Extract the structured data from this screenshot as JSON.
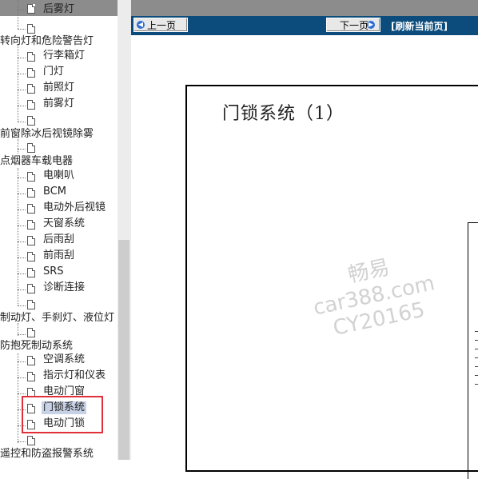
{
  "tree": {
    "items": [
      {
        "label": "后雾灯"
      },
      {
        "label": ""
      },
      {
        "label": "转向灯和危险警告灯"
      },
      {
        "label": "行李箱灯"
      },
      {
        "label": "门灯"
      },
      {
        "label": "前照灯"
      },
      {
        "label": "前雾灯"
      },
      {
        "label": ""
      },
      {
        "label": "前窗除冰后视镜除雾"
      },
      {
        "label": ""
      },
      {
        "label": "点烟器车载电器"
      },
      {
        "label": "电喇叭"
      },
      {
        "label": "BCM"
      },
      {
        "label": "电动外后视镜"
      },
      {
        "label": "天窗系统"
      },
      {
        "label": "后雨刮"
      },
      {
        "label": "前雨刮"
      },
      {
        "label": "SRS"
      },
      {
        "label": "诊断连接"
      },
      {
        "label": ""
      },
      {
        "label": "制动灯、手刹灯、液位灯"
      },
      {
        "label": ""
      },
      {
        "label": "防抱死制动系统"
      },
      {
        "label": "空调系统"
      },
      {
        "label": "指示灯和仪表"
      },
      {
        "label": "电动门窗"
      },
      {
        "label": "门锁系统",
        "selected": true
      },
      {
        "label": "电动门锁"
      },
      {
        "label": ""
      },
      {
        "label": "遥控和防盗报警系统"
      }
    ]
  },
  "viewer": {
    "prev_label": "上一页",
    "next_label": "下一页",
    "refresh_label": "[刷新当前页]",
    "doc_title": "门锁系统（1）",
    "watermark_line1": "畅易",
    "watermark_line2": "car388.com",
    "watermark_line3": "CY20165"
  },
  "colors": {
    "navbar": "#0c4c7c",
    "highlight_box": "#e0303a",
    "selected_bg": "#c8d2e6"
  }
}
